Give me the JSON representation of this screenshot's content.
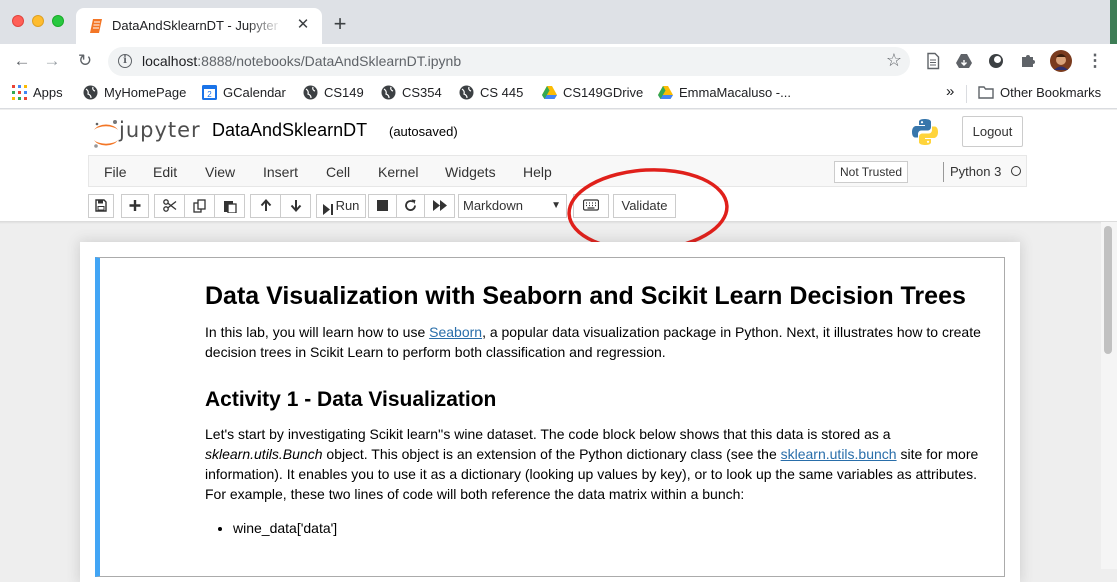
{
  "browser": {
    "tab": {
      "title": "DataAndSklearnDT - Jupyter Notebook",
      "close_glyph": "✕"
    },
    "new_tab_glyph": "+",
    "url": {
      "host": "localhost",
      "rest": ":8888/notebooks/DataAndSklearnDT.ipynb"
    },
    "bookmarks": [
      {
        "label": "Apps",
        "icon": "apps-grid-icon"
      },
      {
        "label": "MyHomePage",
        "icon": "globe-icon"
      },
      {
        "label": "GCalendar",
        "icon": "calendar-icon"
      },
      {
        "label": "CS149",
        "icon": "globe-icon"
      },
      {
        "label": "CS354",
        "icon": "globe-icon"
      },
      {
        "label": "CS 445",
        "icon": "globe-icon"
      },
      {
        "label": "CS149GDrive",
        "icon": "drive-icon"
      },
      {
        "label": "EmmaMacaluso -...",
        "icon": "drive-icon"
      }
    ],
    "bookmarks_overflow": "»",
    "other_bookmarks": "Other Bookmarks",
    "calendar_day": "2"
  },
  "jupyter": {
    "logo_text": "jupyter",
    "notebook_name": "DataAndSklearnDT",
    "autosave": "(autosaved)",
    "logout": "Logout",
    "menu": [
      "File",
      "Edit",
      "View",
      "Insert",
      "Cell",
      "Kernel",
      "Widgets",
      "Help"
    ],
    "not_trusted": "Not Trusted",
    "kernel_name": "Python 3",
    "toolbar": {
      "run_label": "Run",
      "cell_type": "Markdown",
      "validate_label": "Validate"
    }
  },
  "colors": {
    "cell_border_left": "#42a5f5",
    "link": "#296eaa",
    "highlight_ellipse": "#e0201b"
  },
  "cell": {
    "title": "Data Visualization with Seaborn and Scikit Learn Decision Trees",
    "intro_before": "In this lab, you will learn how to use ",
    "intro_link": "Seaborn",
    "intro_after": ", a popular data visualization package in Python. Next, it illustrates how to create decision trees in Scikit Learn to perform both classification and regression.",
    "h2": "Activity 1 - Data Visualization",
    "p_a": "Let's start by investigating Scikit learn''s wine dataset. The code block below shows that this data is stored as a ",
    "p_em": "sklearn.utils.Bunch",
    "p_b": " object. This object is an extension of the Python dictionary class (see the ",
    "p_link": "sklearn.utils.bunch",
    "p_c": " site for more information). It enables you to use it as a dictionary (looking up values by key), or to look up the same variables as attributes. For example, these two lines of code will both reference the data matrix within a bunch:",
    "bullets": [
      "wine_data['data']"
    ]
  }
}
